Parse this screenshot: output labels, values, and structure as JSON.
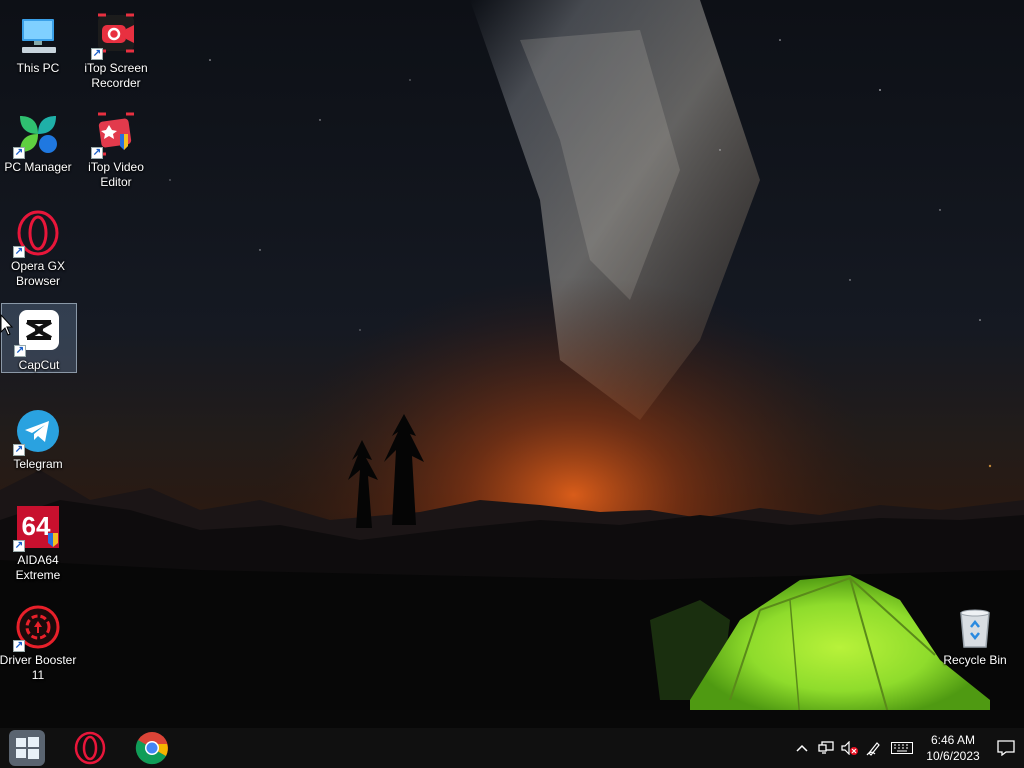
{
  "desktop": {
    "icons": [
      {
        "id": "this-pc",
        "label_lines": [
          "This PC"
        ]
      },
      {
        "id": "itop-screen-recorder",
        "label_lines": [
          "iTop Screen",
          "Recorder"
        ]
      },
      {
        "id": "pc-manager",
        "label_lines": [
          "PC Manager"
        ]
      },
      {
        "id": "itop-video-editor",
        "label_lines": [
          "iTop Video",
          "Editor"
        ]
      },
      {
        "id": "opera-gx-browser",
        "label_lines": [
          "Opera GX",
          "Browser"
        ]
      },
      {
        "id": "capcut",
        "label_lines": [
          "CapCut"
        ],
        "selected": true
      },
      {
        "id": "telegram",
        "label_lines": [
          "Telegram"
        ]
      },
      {
        "id": "aida64-extreme",
        "label_lines": [
          "AIDA64",
          "Extreme"
        ],
        "art_text": "64"
      },
      {
        "id": "driver-booster",
        "label_lines": [
          "Driver Booster",
          "11"
        ]
      },
      {
        "id": "recycle-bin",
        "label_lines": [
          "Recycle Bin"
        ]
      }
    ]
  },
  "taskbar": {
    "pinned": [
      {
        "id": "start",
        "icon": "windows-logo-icon"
      },
      {
        "id": "opera",
        "icon": "opera-icon"
      },
      {
        "id": "chrome",
        "icon": "chrome-icon"
      }
    ],
    "tray": {
      "icons": [
        "chevron-up-icon",
        "network-icon",
        "volume-muted-icon",
        "pen-icon",
        "keyboard-icon"
      ],
      "chevron_glyph": "^"
    },
    "clock": {
      "time": "6:46 AM",
      "date": "10/6/2023"
    }
  },
  "colors": {
    "taskbar": "#101010",
    "selection": "#82a0c8",
    "tent": "#8fdc2c",
    "horizon_glow": "#e2601a"
  }
}
